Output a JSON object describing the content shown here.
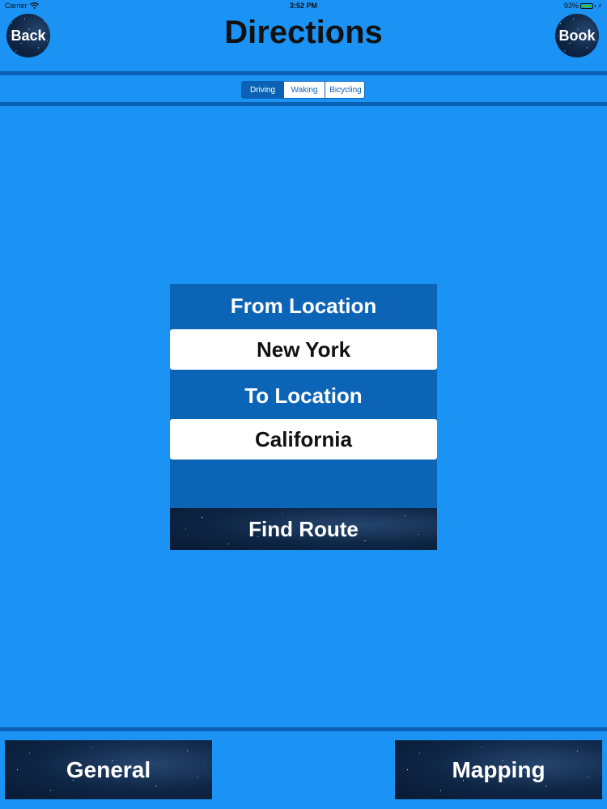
{
  "status_bar": {
    "carrier": "Carrier",
    "time": "3:52 PM",
    "battery": "93%",
    "battery_level": 0.93
  },
  "header": {
    "title": "Directions",
    "back_label": "Back",
    "book_label": "Book"
  },
  "transport_modes": {
    "selected": "Driving",
    "options": [
      "Driving",
      "Waking",
      "Bicycling"
    ]
  },
  "route_form": {
    "from_label": "From Location",
    "from_value": "New York",
    "to_label": "To Location",
    "to_value": "California",
    "find_label": "Find Route"
  },
  "bottom_bar": {
    "general_label": "General",
    "mapping_label": "Mapping"
  },
  "colors": {
    "background": "#1A93F5",
    "accent": "#0B62B5",
    "text": "#111111"
  }
}
